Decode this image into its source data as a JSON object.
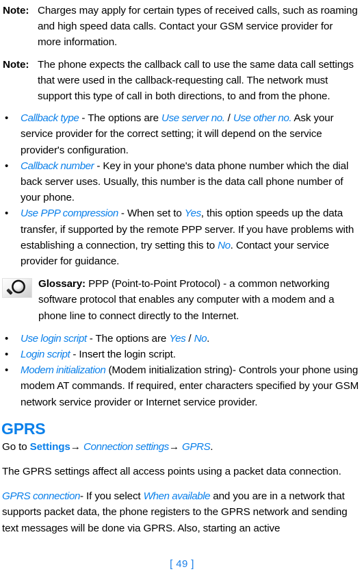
{
  "document": {
    "page_number": "[ 49 ]",
    "accent_color": "#0b80ea",
    "text_color": "#000000"
  },
  "notes": [
    {
      "label": "Note:",
      "text": "Charges may apply for certain types of received calls, such as roaming and high speed data calls. Contact your GSM service provider for more information."
    },
    {
      "label": "Note:",
      "text": "The phone expects the callback call to use the same data call settings that were used in the callback-requesting call. The network must support this type of call in both directions, to and from the phone."
    }
  ],
  "settings_bullets": [
    {
      "term": "Callback type",
      "dash": " - ",
      "lead": "The options are ",
      "option_a": "Use server no.",
      "separator": " / ",
      "option_b": "Use other no.",
      "tail": " Ask your service provider for the correct setting; it will depend on the service provider's configuration."
    },
    {
      "term": "Callback number",
      "dash": " - ",
      "lead": "Key in your phone's data phone number which the dial back server uses. Usually, this number is the data call phone number of your phone.",
      "option_a": "",
      "separator": "",
      "option_b": "",
      "tail": ""
    },
    {
      "term": "Use PPP compression",
      "dash": " - ",
      "lead": "When set to ",
      "option_a": "Yes",
      "mid": ", this option speeds up the data transfer, if supported by the remote PPP server. If you have problems with establishing a connection, try setting this to ",
      "option_b": "No",
      "tail": ". Contact your service provider for guidance."
    }
  ],
  "glossary": {
    "icon": "magnifier-icon",
    "label": "Glossary:",
    "text": " PPP (Point-to-Point Protocol) - a common networking software protocol that enables any computer with a modem and a phone line to connect directly to the Internet."
  },
  "settings_bullets_2": [
    {
      "term": "Use login script",
      "dash": " - ",
      "lead": "The options are ",
      "option_a": "Yes",
      "separator": " / ",
      "option_b": "No",
      "tail": "."
    },
    {
      "term": "Login script",
      "dash": " - ",
      "lead": "Insert the login script.",
      "option_a": "",
      "separator": "",
      "option_b": "",
      "tail": ""
    },
    {
      "term": "Modem initialization",
      "dash": " ",
      "lead": "(Modem initialization string)- Controls your phone using modem AT commands. If required, enter characters specified by your GSM network service provider or Internet service provider.",
      "option_a": "",
      "separator": "",
      "option_b": "",
      "tail": ""
    }
  ],
  "gprs_section": {
    "heading": "GPRS",
    "path_prefix": "Go to ",
    "path_item_1": "Settings",
    "path_arrow_1": "→ ",
    "path_item_2": "Connection settings",
    "path_arrow_2": "→ ",
    "path_item_3": "GPRS",
    "path_suffix": ".",
    "intro": "The GPRS settings affect all access points using a packet data connection.",
    "connection_term": "GPRS connection",
    "connection_dash": "- ",
    "connection_lead": "If you select ",
    "connection_option": "When available",
    "connection_tail": " and you are in a network that supports packet data, the phone registers to the GPRS network and sending text messages will be done via GPRS. Also, starting an active"
  }
}
